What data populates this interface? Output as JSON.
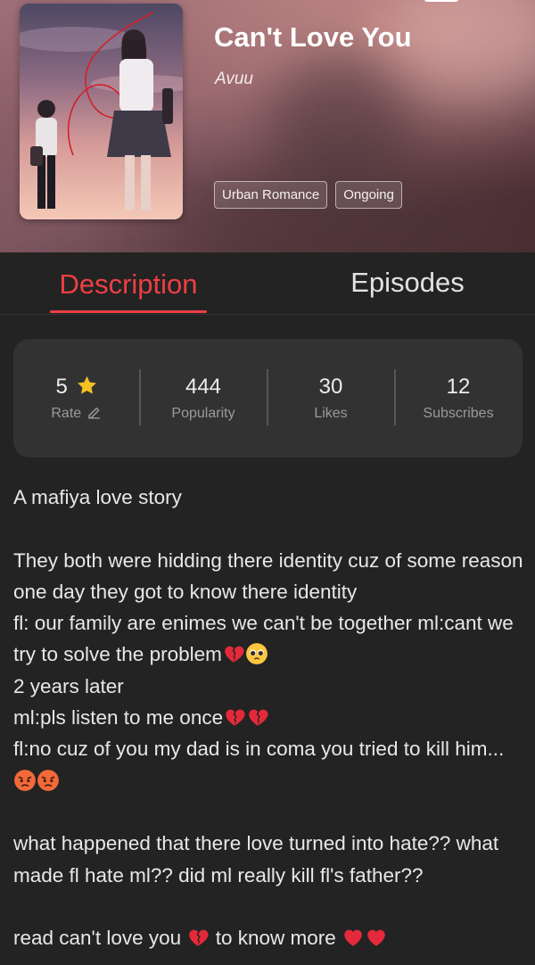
{
  "book": {
    "title": "Can't Love You",
    "author": "Avuu",
    "tags": [
      "Urban Romance",
      "Ongoing"
    ]
  },
  "tabs": {
    "description": "Description",
    "episodes": "Episodes",
    "active": "description"
  },
  "stats": {
    "rate": {
      "value": "5",
      "label": "Rate",
      "icons": [
        "star-icon",
        "edit-icon"
      ]
    },
    "popularity": {
      "value": "444",
      "label": "Popularity"
    },
    "likes": {
      "value": "30",
      "label": "Likes"
    },
    "subscribes": {
      "value": "12",
      "label": "Subscribes"
    }
  },
  "description": {
    "lines": [
      "A mafiya love story",
      "",
      "They both were hidding there identity cuz of some reason one day they got to know there identity",
      "fl: our family are enimes we can't be together ml:cant we try to solve the problem",
      "2 years later",
      "ml:pls listen to me once",
      "fl:no cuz of you my dad is in coma you tried to kill him...",
      "",
      "what happened that there love turned into hate?? what made fl hate ml?? did ml really kill fl's father??",
      "",
      "read can't love you",
      " to know more"
    ],
    "emojis": [
      "broken-heart-emoji",
      "pleading-face-emoji",
      "angry-face-emoji",
      "red-heart-emoji"
    ]
  },
  "colors": {
    "accent": "#ee3f45",
    "background": "#232323",
    "card": "#323232",
    "star": "#f5c024"
  }
}
